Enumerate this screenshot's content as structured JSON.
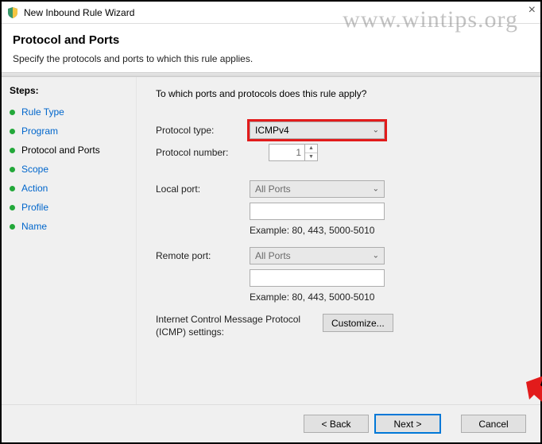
{
  "window": {
    "title": "New Inbound Rule Wizard",
    "close": "×"
  },
  "watermark": "www.wintips.org",
  "header": {
    "title": "Protocol and Ports",
    "subtitle": "Specify the protocols and ports to which this rule applies."
  },
  "sidebar": {
    "title": "Steps:",
    "items": [
      {
        "label": "Rule Type",
        "current": false
      },
      {
        "label": "Program",
        "current": false
      },
      {
        "label": "Protocol and Ports",
        "current": true
      },
      {
        "label": "Scope",
        "current": false
      },
      {
        "label": "Action",
        "current": false
      },
      {
        "label": "Profile",
        "current": false
      },
      {
        "label": "Name",
        "current": false
      }
    ]
  },
  "content": {
    "prompt": "To which ports and protocols does this rule apply?",
    "protocol_type_label": "Protocol type:",
    "protocol_type_value": "ICMPv4",
    "protocol_number_label": "Protocol number:",
    "protocol_number_value": "1",
    "local_port_label": "Local port:",
    "local_port_value": "All Ports",
    "local_port_input": "",
    "local_port_example": "Example: 80, 443, 5000-5010",
    "remote_port_label": "Remote port:",
    "remote_port_value": "All Ports",
    "remote_port_input": "",
    "remote_port_example": "Example: 80, 443, 5000-5010",
    "icmp_label": "Internet Control Message Protocol (ICMP) settings:",
    "customize_btn": "Customize..."
  },
  "footer": {
    "back": "< Back",
    "next": "Next >",
    "cancel": "Cancel"
  }
}
